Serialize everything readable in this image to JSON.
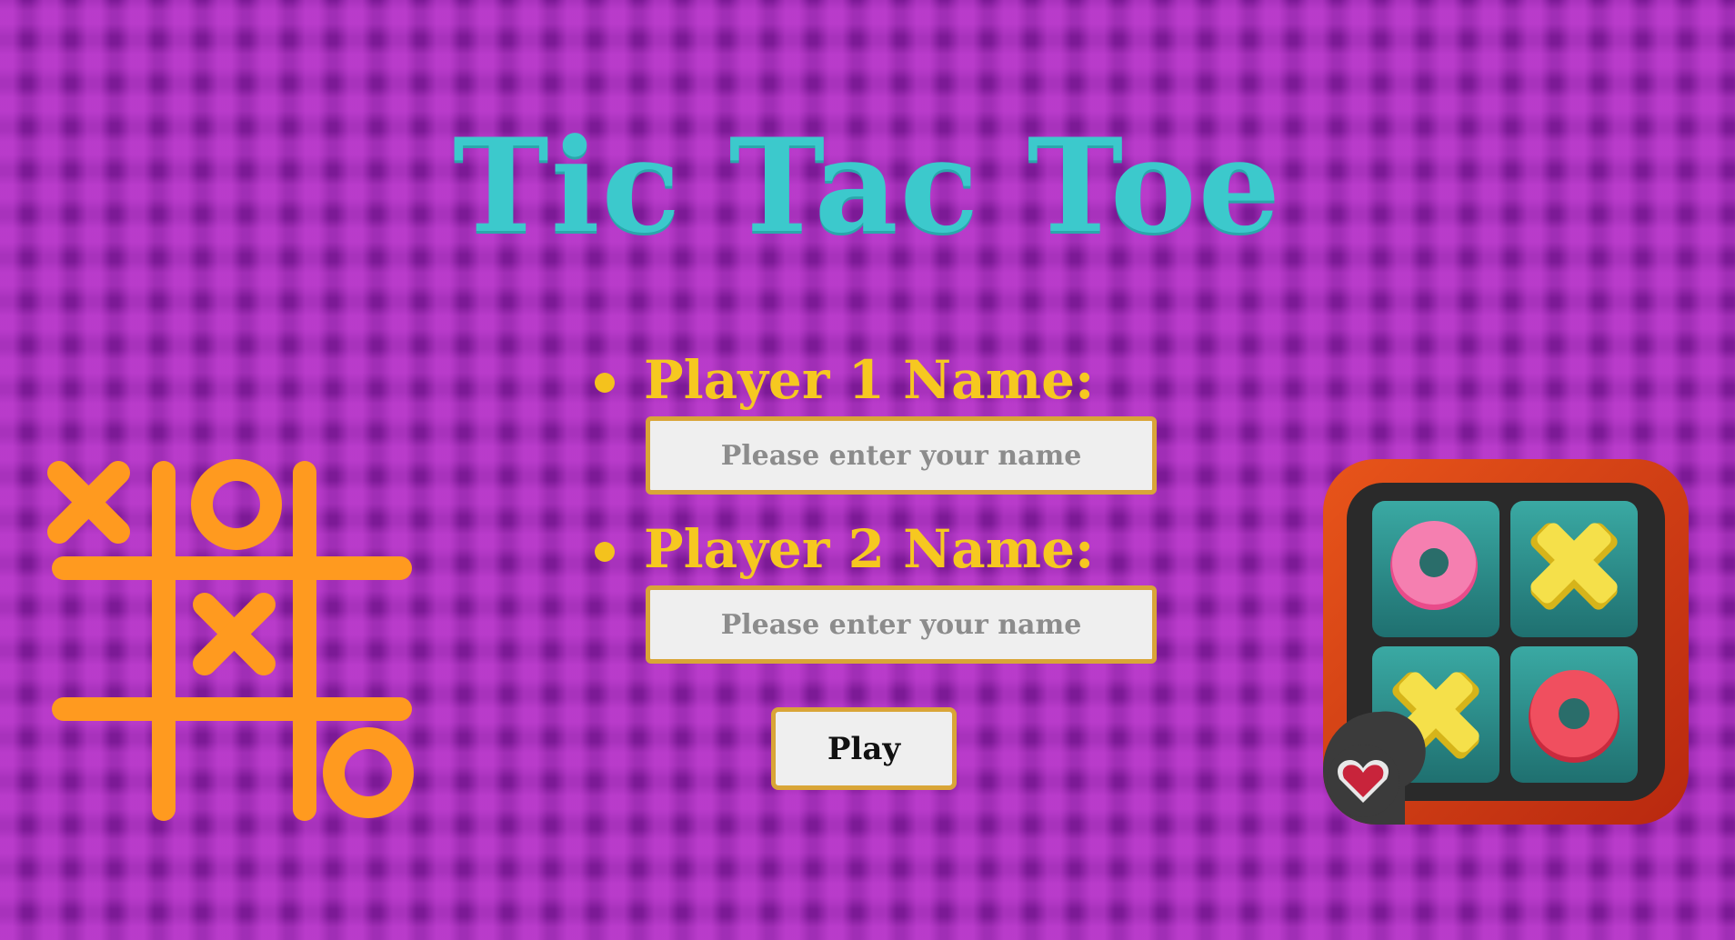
{
  "title": "Tic Tac Toe",
  "players": [
    {
      "label": "Player 1 Name:",
      "input_placeholder": "Please enter your name",
      "input_value": ""
    },
    {
      "label": "Player 2 Name:",
      "input_placeholder": "Please enter your name",
      "input_value": ""
    }
  ],
  "play_button": {
    "label": "Play"
  },
  "decorations": {
    "left": {
      "icon": "tic-tac-toe-grid-icon",
      "color": "#ff9a1f"
    },
    "right": {
      "icon": "tic-tac-toe-app-icon",
      "badge_icon": "heart-badge-icon"
    }
  },
  "colors": {
    "background": "#7c1a96",
    "title": "#3cc9cc",
    "label": "#f6c820",
    "input_border": "#d9a537",
    "input_background": "#efefef"
  }
}
